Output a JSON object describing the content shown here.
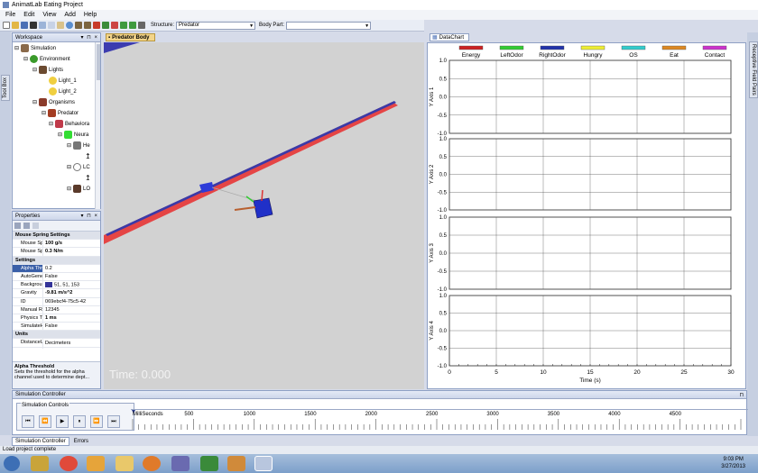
{
  "window": {
    "title": "AnimatLab Eating Project"
  },
  "menu": [
    "File",
    "Edit",
    "View",
    "Add",
    "Help"
  ],
  "toolbar": {
    "structure_label": "Structure:",
    "structure_value": "Predator",
    "bodypart_label": "Body Part:",
    "bodypart_value": ""
  },
  "left_tab": {
    "label": "Tool Box"
  },
  "workspace": {
    "title": "Workspace",
    "tree": [
      {
        "label": "Simulation"
      },
      {
        "label": "Environment"
      },
      {
        "label": "Lights"
      },
      {
        "label": "Light_1"
      },
      {
        "label": "Light_2"
      },
      {
        "label": "Organisms"
      },
      {
        "label": "Predator"
      },
      {
        "label": "Behaviora"
      },
      {
        "label": "Neura"
      },
      {
        "label": "He"
      },
      {
        "label": "LC"
      },
      {
        "label": "LO"
      }
    ]
  },
  "properties": {
    "title": "Properties",
    "rows": [
      {
        "cat": true,
        "key": "Mouse Spring Settings"
      },
      {
        "key": "Mouse Spri",
        "value": "100 g/s",
        "bold": true
      },
      {
        "key": "Mouse Spri",
        "value": "0.3 N/m",
        "bold": true
      },
      {
        "cat": true,
        "key": "Settings"
      },
      {
        "key": "Alpha Thres",
        "value": "0.2",
        "sel": true
      },
      {
        "key": "AutoGenera",
        "value": "False"
      },
      {
        "key": "Backgroun",
        "value": "51, 51, 153",
        "swatch": "#333399"
      },
      {
        "key": "Gravity",
        "value": "-9.81 m/s^2",
        "bold": true
      },
      {
        "key": "ID",
        "value": "069ebcf4-75c5-42"
      },
      {
        "key": "Manual Rar",
        "value": "12345"
      },
      {
        "key": "Physics Tim",
        "value": "1 ms",
        "bold": true
      },
      {
        "key": "SimulateHy",
        "value": "False"
      },
      {
        "cat": true,
        "key": "Units"
      },
      {
        "key": "DistanceUn",
        "value": "Decimeters"
      },
      {
        "key": "MassUnits",
        "value": "Grams"
      }
    ],
    "desc_title": "Alpha Threshold",
    "desc_text": "Sets the threshold for the alpha channel used to determine dept..."
  },
  "viewport": {
    "tab": "Predator Body",
    "time_text": "Time: 0.000",
    "bg": "#d2d2d2"
  },
  "datachart": {
    "tab": "DataChart"
  },
  "right_strip": {
    "label": "Receptive Field Pairs"
  },
  "chart_data": {
    "type": "line",
    "legend": [
      {
        "name": "Energy",
        "color": "#cc2222"
      },
      {
        "name": "LeftOdor",
        "color": "#33cc33"
      },
      {
        "name": "RightOdor",
        "color": "#2233aa"
      },
      {
        "name": "Hungry",
        "color": "#eeee33"
      },
      {
        "name": "OS",
        "color": "#33cccc"
      },
      {
        "name": "Eat",
        "color": "#dd8822"
      },
      {
        "name": "Contact",
        "color": "#cc33cc"
      }
    ],
    "axes": [
      {
        "ylabel": "Y Axis 1",
        "ylim": [
          -1.0,
          1.0
        ]
      },
      {
        "ylabel": "Y Axis 2",
        "ylim": [
          -1.0,
          1.0
        ]
      },
      {
        "ylabel": "Y Axis 3",
        "ylim": [
          -1.0,
          1.0
        ]
      },
      {
        "ylabel": "Y Axis 4",
        "ylim": [
          -1.0,
          1.0
        ]
      }
    ],
    "yticks": [
      "1.0",
      "0.5",
      "0.0",
      "-0.5",
      "-1.0"
    ],
    "xticks": [
      0,
      5,
      10,
      15,
      20,
      25,
      30
    ],
    "xlabel": "Time (s)",
    "xlim": [
      0,
      30
    ],
    "grid": true
  },
  "sim_controller": {
    "title": "Simulation Controller",
    "group_label": "Simulation Controls",
    "buttons": [
      "⏮",
      "⏪",
      "▶",
      "⏸",
      "⏩",
      "⏭"
    ],
    "timeline_label": "MilliSeconds",
    "timeline_ticks": [
      500,
      1000,
      1500,
      2000,
      2500,
      3000,
      3500,
      4000,
      4500
    ]
  },
  "bottom_tabs": [
    "Simulation Controller",
    "Errors"
  ],
  "status": {
    "text": "Load project complete"
  },
  "clock": {
    "time": "9:03 PM",
    "date": "3/27/2013"
  }
}
